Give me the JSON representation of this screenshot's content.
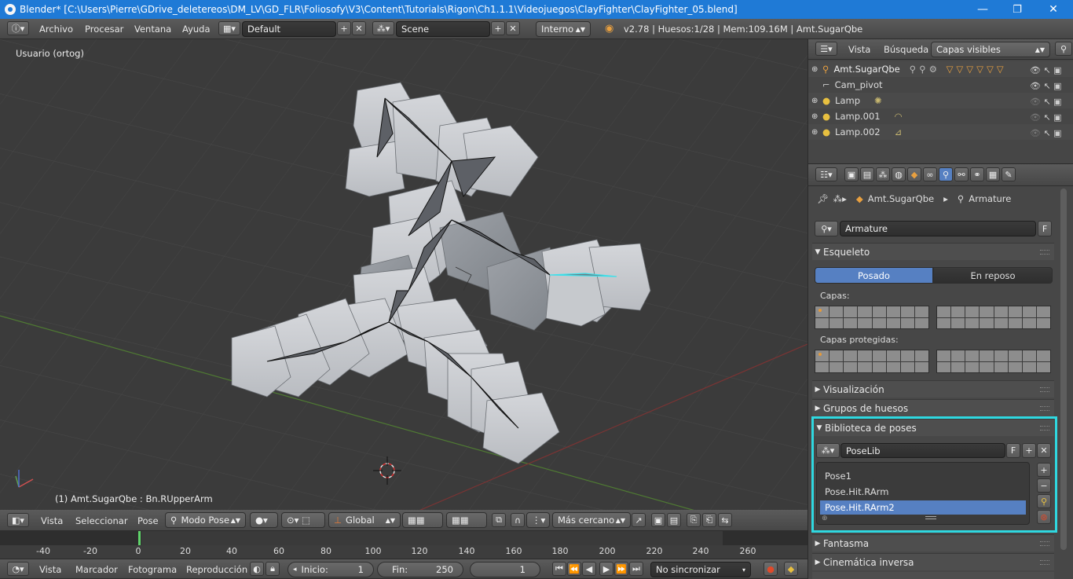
{
  "window": {
    "title": "Blender* [C:\\Users\\Pierre\\GDrive_deletereos\\DM_LV\\GD_FLR\\Foliosofy\\V3\\Content\\Tutorials\\Rigon\\Ch1.1.1\\Videojuegos\\ClayFighter\\ClayFighter_05.blend]",
    "minimize": "—",
    "restore": "❐",
    "close": "✕"
  },
  "info_header": {
    "menus": [
      "Archivo",
      "Procesar",
      "Ventana",
      "Ayuda"
    ],
    "layout": "Default",
    "scene": "Scene",
    "engine": "Interno",
    "stats": "v2.78 | Huesos:1/28 | Mem:109.16M | Amt.SugarQbe"
  },
  "viewport": {
    "view_label": "Usuario (ortog)",
    "object_info": "(1) Amt.SugarQbe : Bn.RUpperArm"
  },
  "view3d_header": {
    "menus": [
      "Vista",
      "Seleccionar",
      "Pose"
    ],
    "mode": "Modo Pose",
    "orientation": "Global",
    "snap_target": "Más cercano"
  },
  "outliner": {
    "menus": [
      "Vista",
      "Búsqueda"
    ],
    "filter": "Capas visibles",
    "items": [
      {
        "name": "Amt.SugarQbe",
        "icon": "armature-icon"
      },
      {
        "name": "Cam_pivot",
        "icon": "empty-icon"
      },
      {
        "name": "Lamp",
        "icon": "lamp-icon"
      },
      {
        "name": "Lamp.001",
        "icon": "lamp-icon"
      },
      {
        "name": "Lamp.002",
        "icon": "lamp-icon"
      }
    ]
  },
  "properties": {
    "breadcrumb": [
      "Amt.SugarQbe",
      "Armature"
    ],
    "datablock": "Armature",
    "fake_user": "F",
    "skeleton": {
      "title": "Esqueleto",
      "pose_btn": "Posado",
      "rest_btn": "En reposo",
      "layers_label": "Capas:",
      "protected_label": "Capas protegidas:"
    },
    "collapsed_panels": [
      "Visualización",
      "Grupos de huesos"
    ],
    "pose_library": {
      "title": "Biblioteca de poses",
      "datablock": "PoseLib",
      "fake_user": "F",
      "poses": [
        "Pose1",
        "Pose.Hit.RArm",
        "Pose.Hit.RArm2"
      ],
      "selected": "Pose.Hit.RArm2",
      "highlight_color": "#2fd8e0"
    },
    "more_panels": [
      "Fantasma",
      "Cinemática inversa"
    ]
  },
  "timeline": {
    "ticks": [
      "-40",
      "-20",
      "0",
      "20",
      "40",
      "60",
      "80",
      "100",
      "120",
      "140",
      "160",
      "180",
      "200",
      "220",
      "240",
      "260"
    ],
    "current_frame_marker": "1"
  },
  "timeline_header": {
    "menus": [
      "Vista",
      "Marcador",
      "Fotograma",
      "Reproducción"
    ],
    "start_label": "Inicio:",
    "start": "1",
    "end_label": "Fin:",
    "end": "250",
    "current": "1",
    "sync": "No sincronizar"
  }
}
